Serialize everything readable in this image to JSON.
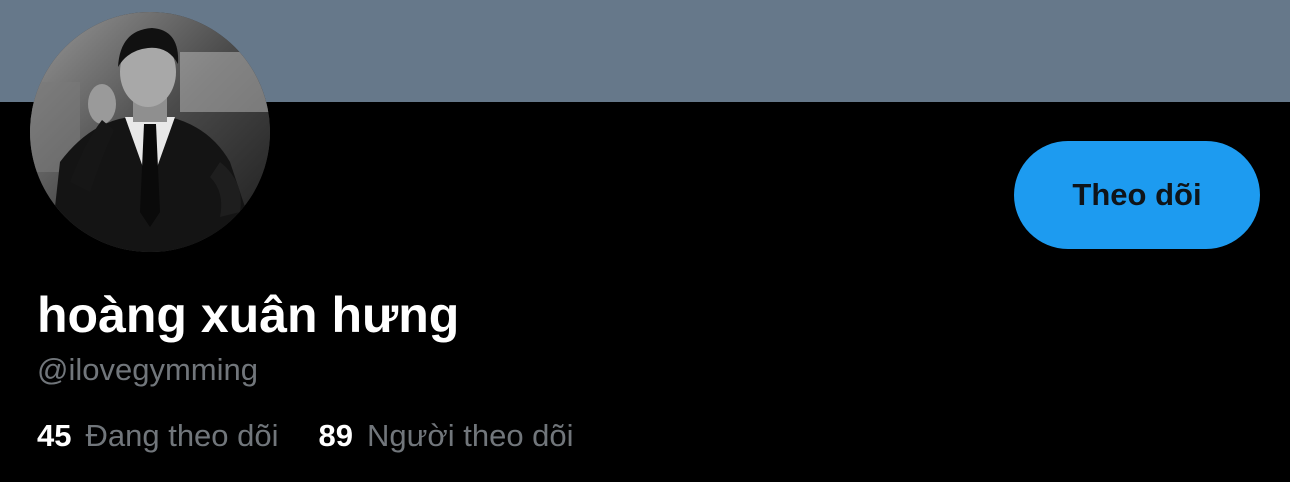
{
  "profile": {
    "display_name": "hoàng xuân hưng",
    "handle": "@ilovegymming",
    "follow_button_label": "Theo dõi",
    "following": {
      "count": "45",
      "label": "Đang theo dõi"
    },
    "followers": {
      "count": "89",
      "label": "Người theo dõi"
    }
  },
  "colors": {
    "banner": "#66788a",
    "background": "#000000",
    "accent": "#1d9bf0",
    "secondary_text": "#71767b"
  },
  "icons": {
    "avatar": "profile-photo-black-and-white"
  }
}
